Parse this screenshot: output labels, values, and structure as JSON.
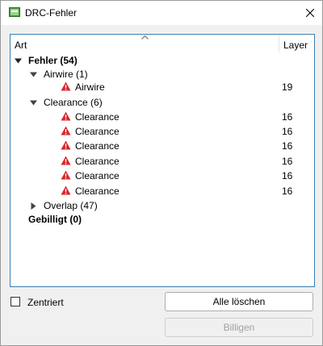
{
  "window": {
    "title": "DRC-Fehler",
    "app_icon": "drc-board-icon",
    "close_icon": "close-icon"
  },
  "table": {
    "col_art": "Art",
    "col_layer": "Layer"
  },
  "tree": {
    "fehler": "Fehler (54)",
    "airwire_group": "Airwire (1)",
    "airwire_item": {
      "label": "Airwire",
      "layer": "19"
    },
    "clearance_group": "Clearance (6)",
    "clearance_items": [
      {
        "label": "Clearance",
        "layer": "16"
      },
      {
        "label": "Clearance",
        "layer": "16"
      },
      {
        "label": "Clearance",
        "layer": "16"
      },
      {
        "label": "Clearance",
        "layer": "16"
      },
      {
        "label": "Clearance",
        "layer": "16"
      },
      {
        "label": "Clearance",
        "layer": "16"
      }
    ],
    "overlap_group": "Overlap (47)",
    "gebilligt": "Gebilligt (0)"
  },
  "controls": {
    "zentriert_label": "Zentriert",
    "zentriert_checked": false,
    "alle_loeschen": "Alle löschen",
    "billigen": "Billigen"
  },
  "colors": {
    "warning": "#d9262b",
    "selection_border": "#3c7fb1"
  }
}
